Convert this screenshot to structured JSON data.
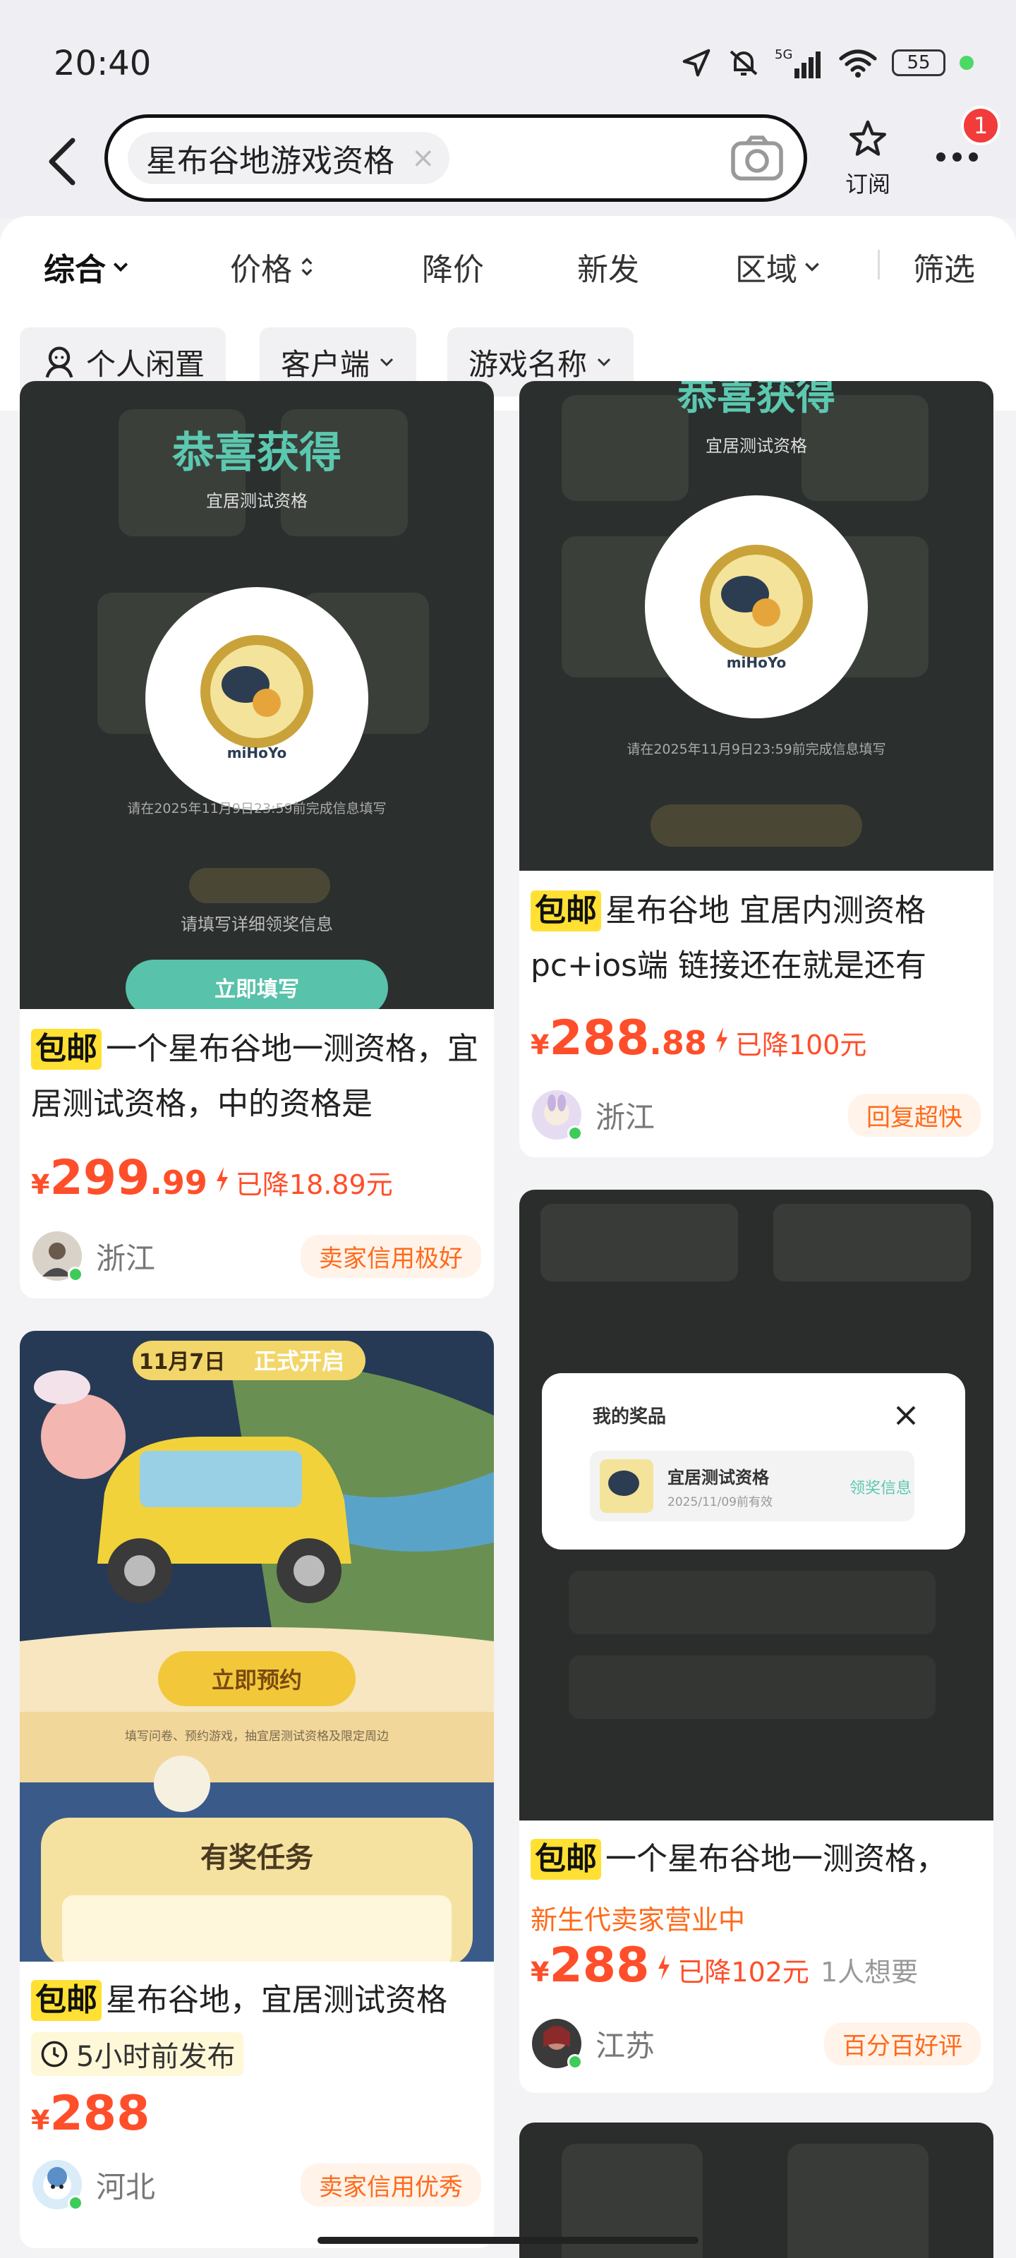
{
  "status": {
    "time": "20:40",
    "signal_label": "5G",
    "battery": "55"
  },
  "search": {
    "query": "星布谷地游戏资格",
    "clear": "×",
    "subscribe_label": "订阅",
    "badge_count": "1"
  },
  "sort_tabs": [
    "综合",
    "价格",
    "降价",
    "新发",
    "区域",
    "筛选"
  ],
  "filter_chips": [
    "个人闲置",
    "客户端",
    "游戏名称"
  ],
  "images": {
    "congrats_title": "恭喜获得",
    "congrats_sub": "宜居测试资格",
    "deadline": "请在2025年11月9日23:59前完成信息填写",
    "fill_hint": "请填写详细领奖信息",
    "fill_btn": "立即填写",
    "promo_date": "11月7日",
    "promo_open": "正式开启",
    "promo_btn": "立即预约",
    "promo_task": "有奖任务",
    "promo_desc": "填写问卷、预约游戏，抽宜居测试资格及限定周边",
    "prize_title": "我的奖品",
    "prize_name": "宜居测试资格",
    "prize_date": "2025/11/09前有效",
    "prize_action": "领奖信息",
    "logo": "miHoYo"
  },
  "cards": [
    {
      "badge": "包邮",
      "title": "一个星布谷地一测资格，宜居测试资格，中的资格是",
      "yen": "¥",
      "price_int": "299",
      "price_dec": ".99",
      "drop": "已降18.89元",
      "region": "浙江",
      "tag": "卖家信用极好"
    },
    {
      "badge": "包邮",
      "title": "星布谷地 宜居内测资格pc+ios端 链接还在就是还有",
      "yen": "¥",
      "price_int": "288",
      "price_dec": ".88",
      "drop": "已降100元",
      "region": "浙江",
      "tag": "回复超快"
    },
    {
      "badge": "包邮",
      "title": "星布谷地，宜居测试资格",
      "posted": "5小时前发布",
      "yen": "¥",
      "price_int": "288",
      "price_dec": "",
      "region": "河北",
      "tag": "卖家信用优秀"
    },
    {
      "badge": "包邮",
      "title": "一个星布谷地一测资格，",
      "sub": "新生代卖家营业中",
      "yen": "¥",
      "price_int": "288",
      "price_dec": "",
      "drop": "已降102元",
      "wants": "1人想要",
      "region": "江苏",
      "tag": "百分百好评"
    }
  ],
  "colors": {
    "accent": "#ff4e2a",
    "tag_orange": "#ff6a1a",
    "baoyou_yellow": "#ffe033",
    "teal": "#5cc8b0"
  }
}
